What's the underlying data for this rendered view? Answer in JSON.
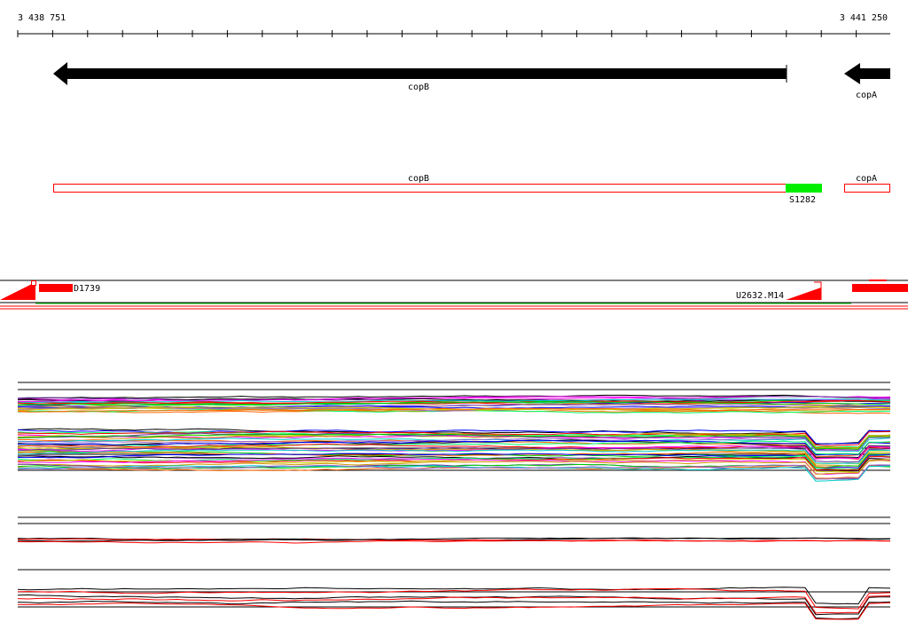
{
  "ruler": {
    "start_label": "3 438 751",
    "end_label": "3 441 250"
  },
  "genes": [
    {
      "name": "copB",
      "strand": "-"
    },
    {
      "name": "copA",
      "strand": "-"
    }
  ],
  "cds": [
    {
      "name": "copB"
    },
    {
      "name": "copA"
    }
  ],
  "probes": [
    {
      "name": "S1282",
      "color": "#00ee00"
    }
  ],
  "features": [
    {
      "name": "D1739",
      "color": "#ff0000"
    },
    {
      "name": "U2632.M14",
      "color": "#ff0000"
    }
  ],
  "colors": {
    "gene_arrow": "#000000",
    "cds_outline": "#ff0000",
    "feature": "#ff0000",
    "probe": "#00ee00"
  },
  "signal_panels": [
    {
      "panel": "multi-sample expression traces",
      "palette": [
        "#000000",
        "#ff00ff",
        "#00cccc",
        "#ff0000",
        "#00cc00",
        "#0000ff",
        "#cc9900",
        "#9966cc",
        "#cccc00",
        "#ff6600",
        "#00ff66",
        "#663399"
      ]
    },
    {
      "panel": "summary traces",
      "palette": [
        "#000000",
        "#ff0000"
      ]
    }
  ]
}
